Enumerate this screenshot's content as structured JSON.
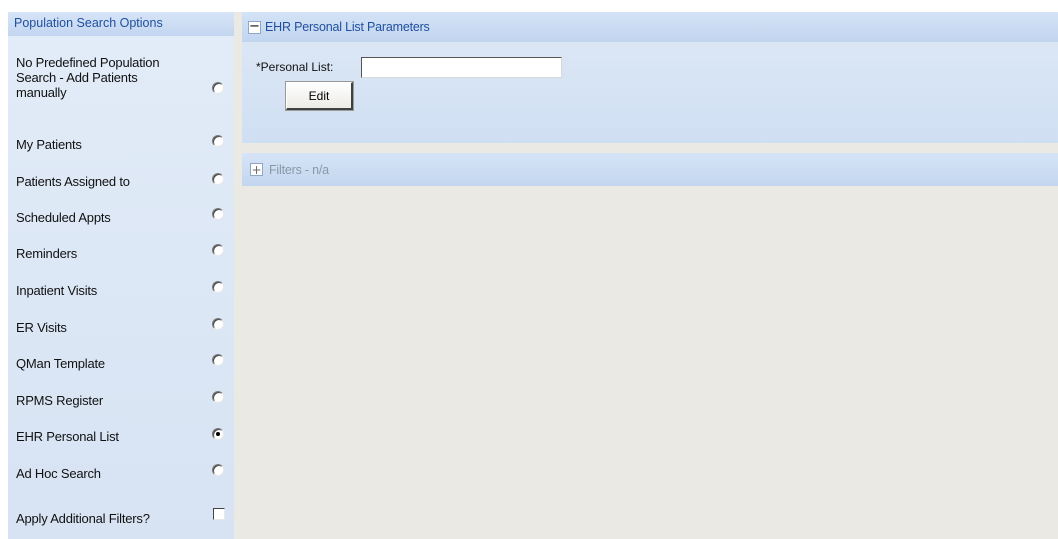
{
  "left_panel": {
    "title": "Population Search Options",
    "options": [
      {
        "label": "No Predefined Population Search - Add Patients manually",
        "selected": false
      },
      {
        "label": "My Patients",
        "selected": false
      },
      {
        "label": "Patients Assigned to",
        "selected": false
      },
      {
        "label": "Scheduled Appts",
        "selected": false
      },
      {
        "label": "Reminders",
        "selected": false
      },
      {
        "label": "Inpatient Visits",
        "selected": false
      },
      {
        "label": "ER Visits",
        "selected": false
      },
      {
        "label": "QMan Template",
        "selected": false
      },
      {
        "label": "RPMS Register",
        "selected": false
      },
      {
        "label": "EHR Personal List",
        "selected": true
      },
      {
        "label": "Ad Hoc Search",
        "selected": false
      }
    ],
    "apply_filters": {
      "label": "Apply Additional Filters?",
      "checked": false
    }
  },
  "params_panel": {
    "toggle": "−",
    "title": "EHR Personal List Parameters",
    "personal_list_label": "*Personal List:",
    "personal_list_value": "",
    "edit_label": "Edit"
  },
  "filters_panel": {
    "toggle": "+",
    "title": "Filters - n/a"
  },
  "colors": {
    "header_text": "#1f4f9e",
    "panel_bg": "#dde8f6",
    "content_bg": "#ebe9e3"
  }
}
